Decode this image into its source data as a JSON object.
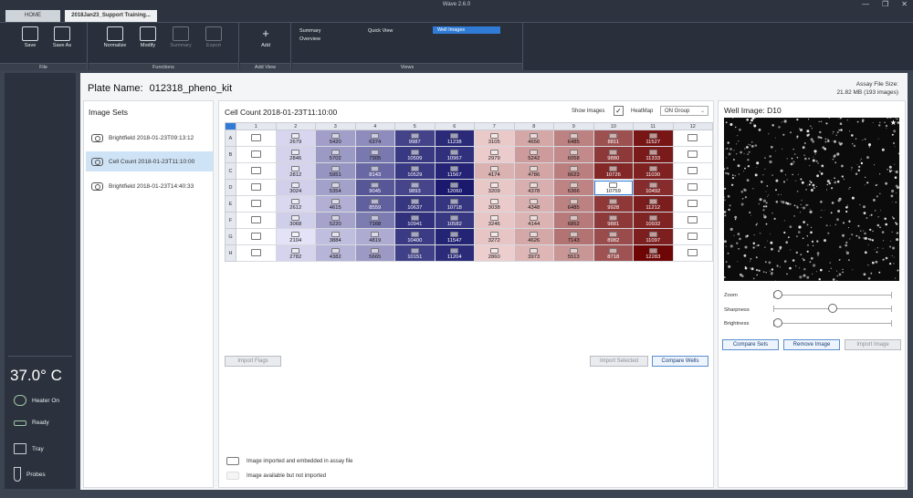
{
  "window": {
    "title": "Wave 2.6.0",
    "controls": [
      "—",
      "❐",
      "✕"
    ]
  },
  "tabs": {
    "home": "HOME",
    "file": "2018Jan23_Support Training..."
  },
  "ribbon": {
    "file_group": "File",
    "save": "Save",
    "save_as": "Save As",
    "functions_group": "Functions",
    "normalize": "Normalize",
    "modify": "Modify",
    "summary": "Summary",
    "export": "Export",
    "addview_group": "Add View",
    "add": "Add",
    "views_group": "Views",
    "views": {
      "summary": "Summary",
      "overview": "Overview",
      "quick_view": "Quick View",
      "well_images": "Well Images"
    }
  },
  "status": {
    "temperature": "37.0° C",
    "heater": "Heater On",
    "ready": "Ready",
    "tray": "Tray",
    "probes": "Probes"
  },
  "plate": {
    "title_label": "Plate Name:",
    "name": "012318_pheno_kit",
    "file_size_label": "Assay File Size:",
    "file_size": "21.82 MB  (193 images)"
  },
  "image_sets": {
    "title": "Image Sets",
    "items": [
      "Brightfield 2018-01-23T09:13:12",
      "Cell Count 2018-01-23T11:10:00",
      "Brightfield 2018-01-23T14:40:33"
    ],
    "selected_index": 1
  },
  "cell_count": {
    "title": "Cell Count 2018-01-23T11:10:00",
    "show_images": "Show Images",
    "show_images_checked": "✓",
    "heatmap_label": "HeatMap",
    "heatmap_value": "ON Group",
    "columns": [
      "1",
      "2",
      "3",
      "4",
      "5",
      "6",
      "7",
      "8",
      "9",
      "10",
      "11",
      "12"
    ],
    "rows": [
      "A",
      "B",
      "C",
      "D",
      "E",
      "F",
      "G",
      "H"
    ],
    "values": [
      [
        "",
        "2679",
        "5420",
        "6374",
        "9987",
        "11238",
        "3105",
        "4656",
        "6485",
        "8811",
        "11527",
        ""
      ],
      [
        "",
        "2846",
        "5702",
        "7305",
        "10509",
        "10967",
        "2979",
        "5242",
        "6058",
        "9880",
        "11333",
        ""
      ],
      [
        "",
        "2812",
        "5951",
        "8143",
        "10529",
        "11567",
        "4174",
        "4786",
        "6623",
        "10726",
        "11030",
        ""
      ],
      [
        "",
        "3024",
        "5354",
        "9045",
        "9893",
        "12060",
        "3209",
        "4378",
        "6366",
        "10759",
        "10492",
        ""
      ],
      [
        "",
        "2612",
        "4615",
        "8559",
        "10637",
        "10718",
        "3038",
        "4348",
        "6485",
        "9928",
        "11212",
        ""
      ],
      [
        "",
        "3068",
        "5220",
        "7168",
        "10941",
        "10582",
        "3246",
        "4144",
        "6852",
        "9881",
        "10932",
        ""
      ],
      [
        "",
        "2104",
        "3884",
        "4819",
        "10400",
        "11547",
        "3272",
        "4626",
        "7143",
        "8982",
        "11097",
        ""
      ],
      [
        "",
        "2782",
        "4382",
        "5665",
        "10151",
        "11204",
        "2860",
        "3973",
        "5513",
        "8718",
        "12283",
        ""
      ]
    ],
    "selected_well": "D10",
    "colors": {
      "blue_low": "#e4e2f6",
      "blue_high": "#15156b",
      "red_low": "#f7dede",
      "red_high": "#6e0606",
      "selected_outline": "#2f7bd6"
    },
    "buttons": {
      "import_flags": "Import Flags",
      "import_selected": "Import Selected",
      "compare_wells": "Compare Wells"
    },
    "legend": {
      "imported": "Image imported and embedded in assay file",
      "available": "Image available but not imported"
    }
  },
  "well_image": {
    "title": "Well Image: D10",
    "star_icon": "★",
    "zoom": "Zoom",
    "sharpness": "Sharpness",
    "brightness": "Brightness",
    "zoom_level": 0.0,
    "sharpness_level": 0.5,
    "brightness_level": 0.0,
    "buttons": {
      "compare_sets": "Compare Sets",
      "remove_image": "Remove Image",
      "import_image": "Import Image"
    }
  }
}
